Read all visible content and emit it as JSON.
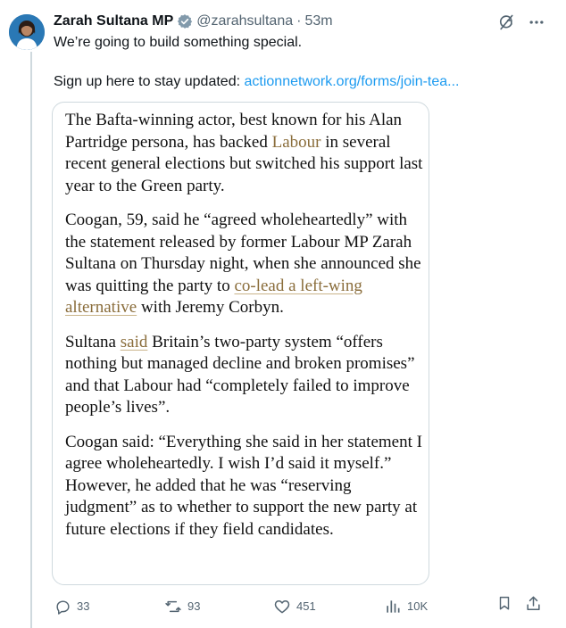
{
  "author": {
    "name": "Zarah Sultana MP",
    "handle": "@zarahsultana",
    "separator": "·",
    "time": "53m"
  },
  "tweet": {
    "line1": "We’re going to build something special.",
    "line2_prefix": "Sign up here to stay updated:",
    "link_text": "actionnetwork.org/forms/join-tea..."
  },
  "article": {
    "p1": {
      "a": "The Bafta-winning actor, best known for his Alan Partridge persona, has backed",
      "link": "Labour",
      "b": "in several recent general elections but switched his support last year to the Green party."
    },
    "p2": {
      "a": "Coogan, 59, said he “agreed wholeheartedly” with the statement released by former Labour MP Zarah Sultana on Thursday night, when she announced she was quitting the party to",
      "link": "co-lead a left-wing alternative",
      "b": "with Jeremy Corbyn."
    },
    "p3": {
      "a": "Sultana",
      "link": "said",
      "b": "Britain’s two-party system “offers nothing but managed decline and broken promises” and that Labour had “completely failed to improve people’s lives”."
    },
    "p4": "Coogan said: “Everything she said in her statement I agree wholeheartedly. I wish I’d said it myself.” However, he added that he was “reserving judgment” as to whether to support the new party at future elections if they field candidates."
  },
  "stats": {
    "replies": "33",
    "reposts": "93",
    "likes": "451",
    "views": "10K"
  },
  "icons": {
    "verified": "verified-badge-icon",
    "grok": "grok-icon",
    "more": "more-icon",
    "reply": "reply-icon",
    "repost": "repost-icon",
    "like": "like-icon",
    "views": "views-icon",
    "bookmark": "bookmark-icon",
    "share": "share-icon"
  },
  "colors": {
    "link": "#1d9bf0",
    "article_link": "#8a6d3b",
    "muted": "#536471",
    "border": "#cfd9de"
  }
}
